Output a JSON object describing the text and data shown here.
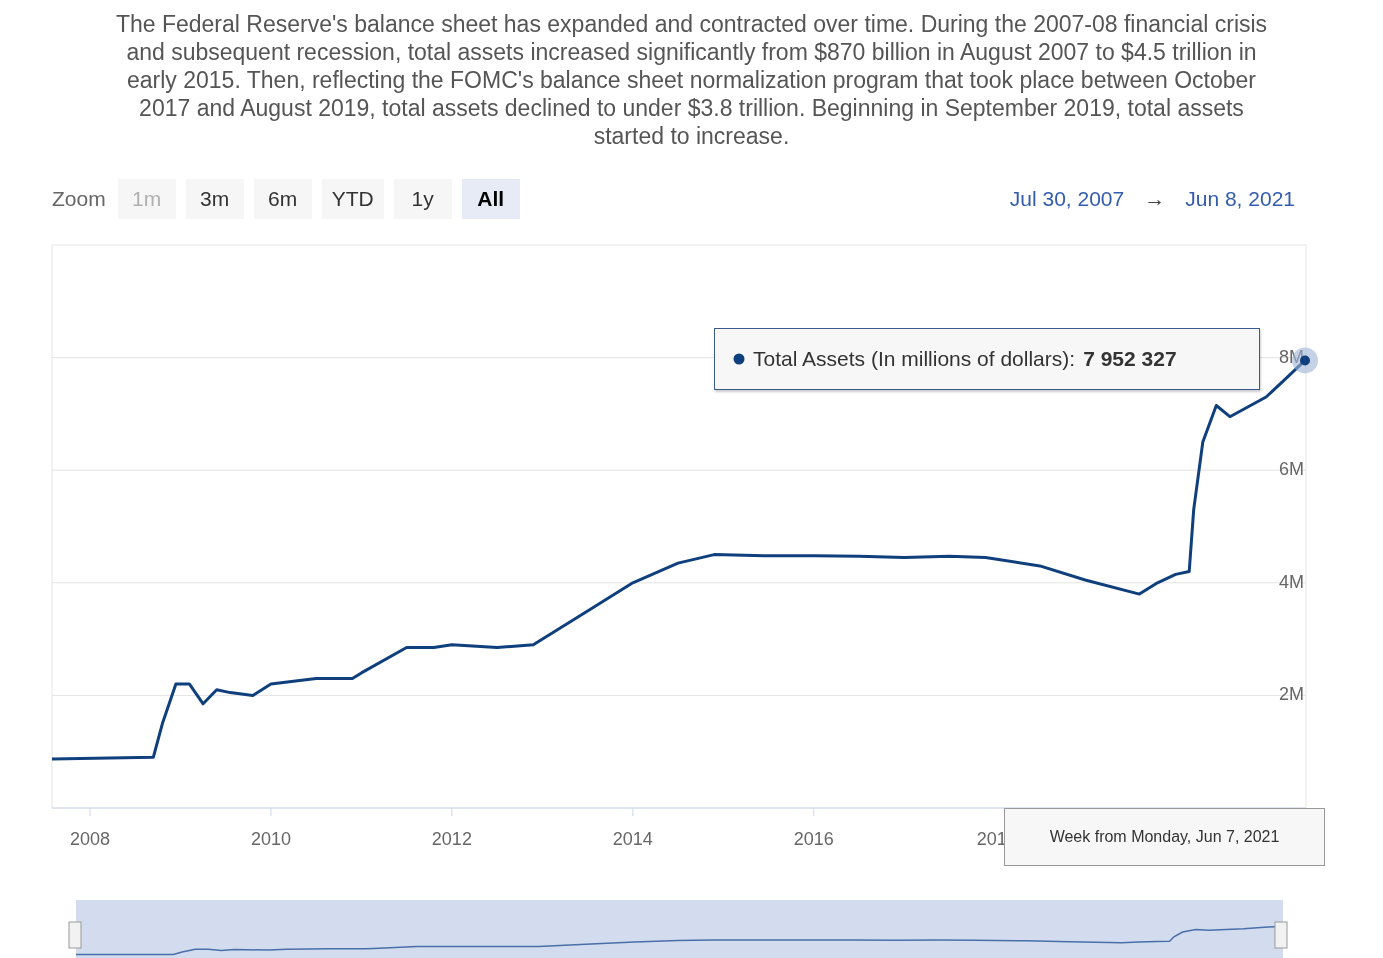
{
  "description": "The Federal Reserve's balance sheet has expanded and contracted over time. During the 2007-08 financial crisis and subsequent recession, total assets increased significantly from $870 billion in August 2007 to $4.5 trillion in early 2015. Then, reflecting the FOMC's balance sheet normalization program that took place between October 2017 and August 2019, total assets declined to under $3.8 trillion. Beginning in September 2019, total assets started to increase.",
  "zoom": {
    "label": "Zoom",
    "buttons": [
      {
        "label": "1m",
        "selected": false,
        "disabled": true
      },
      {
        "label": "3m",
        "selected": false,
        "disabled": false
      },
      {
        "label": "6m",
        "selected": false,
        "disabled": false
      },
      {
        "label": "YTD",
        "selected": false,
        "disabled": false
      },
      {
        "label": "1y",
        "selected": false,
        "disabled": false
      },
      {
        "label": "All",
        "selected": true,
        "disabled": false
      }
    ]
  },
  "range": {
    "from": "Jul 30, 2007",
    "arrow": "→",
    "to": "Jun 8, 2021"
  },
  "chart": {
    "chart_data": {
      "type": "line",
      "x": [
        2007.58,
        2008.7,
        2008.8,
        2008.95,
        2009.1,
        2009.25,
        2009.4,
        2009.55,
        2009.8,
        2010.0,
        2010.5,
        2010.9,
        2011.0,
        2011.5,
        2011.8,
        2012.0,
        2012.5,
        2012.9,
        2013.5,
        2014.0,
        2014.5,
        2014.9,
        2015.5,
        2016.0,
        2016.5,
        2017.0,
        2017.5,
        2017.9,
        2018.5,
        2019.0,
        2019.6,
        2019.8,
        2020.0,
        2020.15,
        2020.2,
        2020.3,
        2020.45,
        2020.6,
        2021.0,
        2021.2,
        2021.43
      ],
      "series": [
        {
          "name": "Total Assets (In millions of dollars)",
          "color": "#0f3f7c",
          "values": [
            0.87,
            0.9,
            1.5,
            2.2,
            2.2,
            1.85,
            2.1,
            2.05,
            2.0,
            2.2,
            2.3,
            2.3,
            2.4,
            2.85,
            2.85,
            2.9,
            2.85,
            2.9,
            3.5,
            4.0,
            4.35,
            4.5,
            4.48,
            4.48,
            4.47,
            4.45,
            4.47,
            4.45,
            4.3,
            4.05,
            3.8,
            4.0,
            4.15,
            4.2,
            5.3,
            6.5,
            7.15,
            6.95,
            7.3,
            7.6,
            7.95
          ]
        }
      ],
      "xlim": [
        2007.58,
        2021.43
      ],
      "ylim": [
        0,
        10
      ],
      "xticks": [
        2008,
        2010,
        2012,
        2014,
        2016
      ],
      "grid": true,
      "yticks": [
        {
          "value": 2,
          "label": "2M"
        },
        {
          "value": 4,
          "label": "4M"
        },
        {
          "value": 6,
          "label": "6M"
        },
        {
          "value": 8,
          "label": "8M"
        }
      ]
    },
    "covered_tick_label": "201"
  },
  "tooltip": {
    "separator": ":",
    "value": "7 952 327"
  },
  "date_tooltip": "Week from Monday, Jun 7, 2021"
}
